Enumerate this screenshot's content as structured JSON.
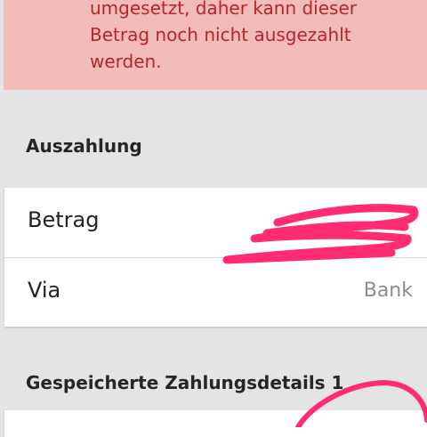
{
  "alert": {
    "message": "umgesetzt, daher kann dieser\nBetrag noch nicht ausgezahlt\nwerden."
  },
  "payout": {
    "section_title": "Auszahlung",
    "amount_label": "Betrag",
    "via_label": "Via",
    "via_value": "Bank"
  },
  "saved_details": {
    "section_title": "Gespeicherte Zahlungsdetails 1"
  },
  "colors": {
    "alert_background": "#f2bcb8",
    "alert_text": "#b8242a",
    "redaction_scribble": "#ff2d6f"
  }
}
